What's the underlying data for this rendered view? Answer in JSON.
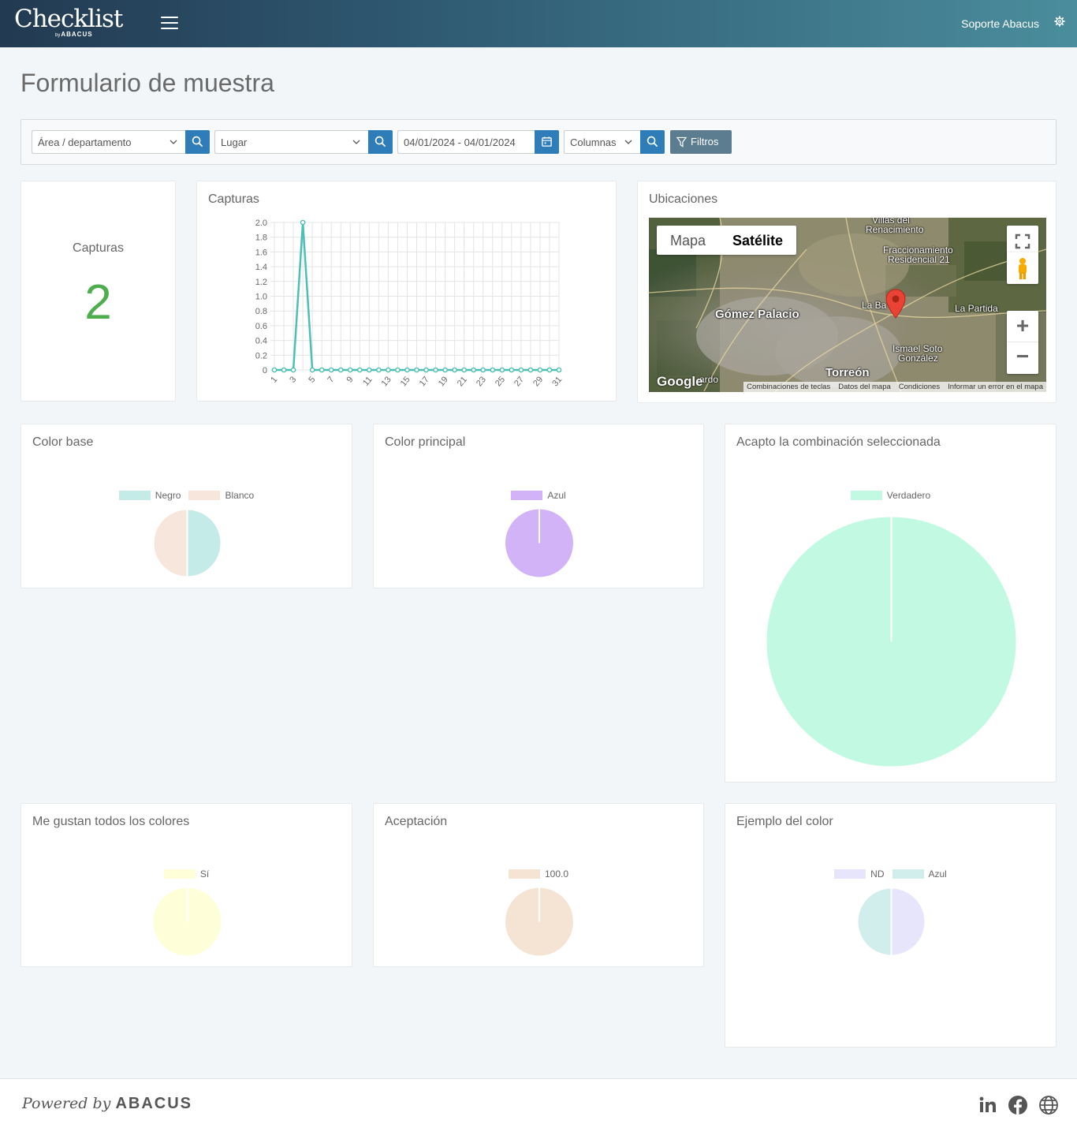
{
  "header": {
    "brand": "Checklist",
    "brand_by": "by",
    "brand_sub": "ABACUS",
    "user": "Soporte Abacus"
  },
  "page": {
    "title": "Formulario de muestra"
  },
  "filters": {
    "area": "Área / departamento",
    "lugar": "Lugar",
    "date_range": "04/01/2024 - 04/01/2024",
    "columnas": "Columnas",
    "filtros": "Filtros"
  },
  "kpi": {
    "label": "Capturas",
    "value": "2"
  },
  "captures_chart": {
    "title": "Capturas",
    "chart_data": {
      "type": "line",
      "title": "Capturas",
      "x": [
        1,
        2,
        3,
        4,
        5,
        6,
        7,
        8,
        9,
        10,
        11,
        12,
        13,
        14,
        15,
        16,
        17,
        18,
        19,
        20,
        21,
        22,
        23,
        24,
        25,
        26,
        27,
        28,
        29,
        30,
        31
      ],
      "values": [
        0,
        0,
        0,
        2,
        0,
        0,
        0,
        0,
        0,
        0,
        0,
        0,
        0,
        0,
        0,
        0,
        0,
        0,
        0,
        0,
        0,
        0,
        0,
        0,
        0,
        0,
        0,
        0,
        0,
        0,
        0
      ],
      "x_ticks": [
        "1",
        "3",
        "5",
        "7",
        "9",
        "11",
        "13",
        "15",
        "17",
        "19",
        "21",
        "23",
        "25",
        "27",
        "29",
        "31"
      ],
      "y_ticks": [
        "0",
        "0.2",
        "0.4",
        "0.6",
        "0.8",
        "1.0",
        "1.2",
        "1.4",
        "1.6",
        "1.8",
        "2.0"
      ],
      "ylim": [
        0,
        2
      ],
      "grid": true,
      "color": "#4dbfb4"
    }
  },
  "map": {
    "title": "Ubicaciones",
    "tab_map": "Mapa",
    "tab_sat": "Satélite",
    "labels": {
      "villas": "Villas del",
      "renacimiento": "Renacimiento",
      "fracc": "Fraccionamiento",
      "residencial": "Residencial 21",
      "gomez": "Gómez Palacio",
      "la_barranca": "La Ba     ca",
      "la_partida": "La Partida",
      "ismael": "Ismael Soto",
      "gonzalez": "González",
      "torreon": "Torreón",
      "ardo": "ardo"
    },
    "google": "Google",
    "footer_links": [
      "Combinaciones de teclas",
      "Datos del mapa",
      "Condiciones",
      "Informar un error en el mapa"
    ],
    "zoom_in": "+",
    "zoom_out": "−"
  },
  "pies": [
    {
      "title": "Color base",
      "chart_data": {
        "type": "pie",
        "categories": [
          "Negro",
          "Blanco"
        ],
        "values": [
          1,
          1
        ],
        "colors": [
          "#c5ebe8",
          "#f6e6db"
        ]
      }
    },
    {
      "title": "Color principal",
      "chart_data": {
        "type": "pie",
        "categories": [
          "Azul"
        ],
        "values": [
          2
        ],
        "colors": [
          "#d3b3f7"
        ]
      }
    },
    {
      "title": "Acapto la combinación seleccionada",
      "chart_data": {
        "type": "pie",
        "categories": [
          "Verdadero"
        ],
        "values": [
          2
        ],
        "colors": [
          "#c1f9e2"
        ]
      }
    },
    {
      "title": "Me gustan todos los colores",
      "chart_data": {
        "type": "pie",
        "categories": [
          "Sí"
        ],
        "values": [
          2
        ],
        "colors": [
          "#feffd9"
        ]
      }
    },
    {
      "title": "Aceptación",
      "chart_data": {
        "type": "pie",
        "categories": [
          "100.0"
        ],
        "values": [
          2
        ],
        "colors": [
          "#f5e4d4"
        ]
      }
    },
    {
      "title": "Ejemplo del color",
      "chart_data": {
        "type": "pie",
        "categories": [
          "ND",
          "Azul"
        ],
        "values": [
          1,
          1
        ],
        "colors": [
          "#e7e5fc",
          "#d1eeed"
        ]
      }
    }
  ],
  "footer": {
    "powered": "Powered by",
    "brand": "ABACUS"
  }
}
